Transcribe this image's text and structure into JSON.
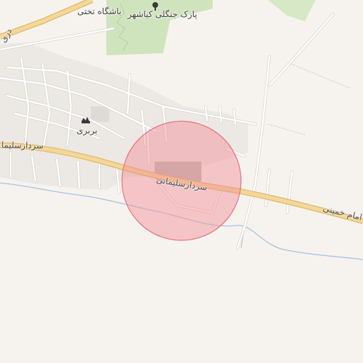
{
  "labels": {
    "park": "پارک جنگلی کیاشهر",
    "club": "باشگاه تختی",
    "village": "بربری",
    "road_main_center": "سردارسلیمانی",
    "road_main_left": "سردارسلیما",
    "road_main_right": "امام خمینی",
    "road_top_left": "دری"
  },
  "icons": {
    "park": "tree-icon",
    "village": "village-icon"
  },
  "colors": {
    "background": "#f6f3ef",
    "park_green": "#cfe4bd",
    "main_road_fill": "#f3d79a",
    "main_road_casing": "#e0b964",
    "minor_road": "#ffffff",
    "minor_road_casing": "#d9d6d1",
    "water": "#a9c3de",
    "highlight_fill": "#f28b95",
    "highlight_stroke": "#e9717e"
  },
  "highlight": {
    "shape": "circle",
    "opacity": 0.45
  }
}
